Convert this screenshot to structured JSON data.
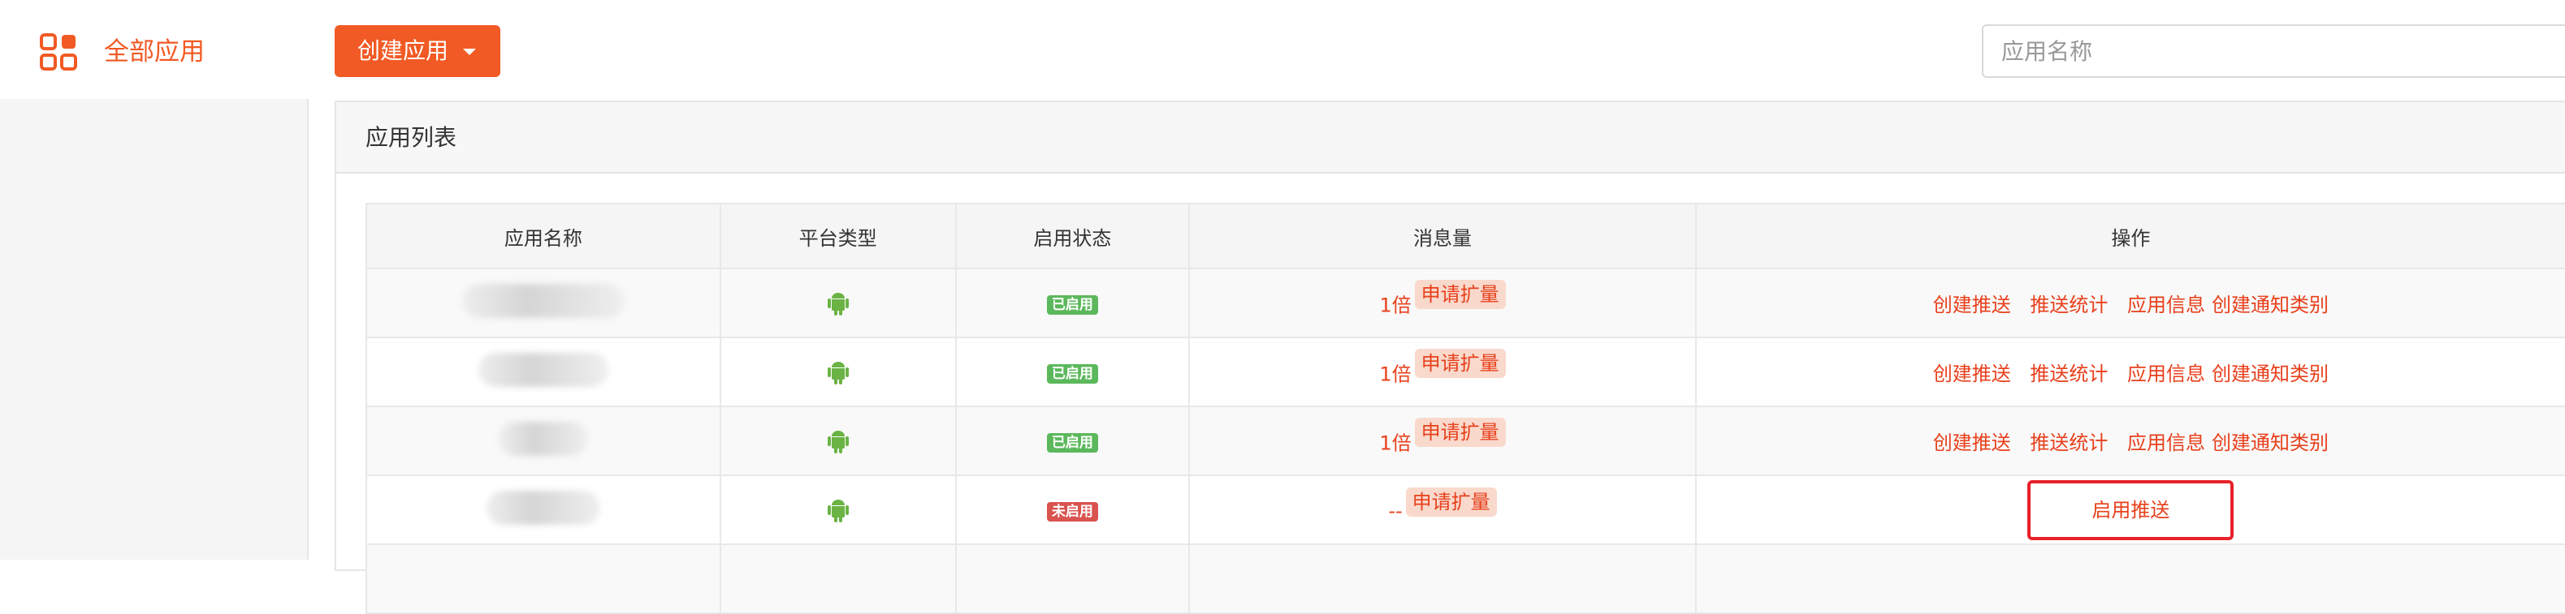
{
  "header": {
    "logo_icon": "grid-apps-icon",
    "title": "全部应用",
    "create_button": "创建应用",
    "search_placeholder": "应用名称",
    "accent_color": "#f15a24"
  },
  "panel": {
    "title": "应用列表"
  },
  "table": {
    "columns": [
      "应用名称",
      "平台类型",
      "启用状态",
      "消息量",
      "操作"
    ],
    "rows": [
      {
        "name": "",
        "platform_icon": "android-icon",
        "status": "已启用",
        "enabled": true,
        "message_count": "1倍",
        "expand_label": "申请扩量",
        "operations": [
          "创建推送",
          "推送统计",
          "应用信息",
          "创建通知类别"
        ]
      },
      {
        "name": "",
        "platform_icon": "android-icon",
        "status": "已启用",
        "enabled": true,
        "message_count": "1倍",
        "expand_label": "申请扩量",
        "operations": [
          "创建推送",
          "推送统计",
          "应用信息",
          "创建通知类别"
        ]
      },
      {
        "name": "",
        "platform_icon": "android-icon",
        "status": "已启用",
        "enabled": true,
        "message_count": "1倍",
        "expand_label": "申请扩量",
        "operations": [
          "创建推送",
          "推送统计",
          "应用信息",
          "创建通知类别"
        ]
      },
      {
        "name": "",
        "platform_icon": "android-icon",
        "status": "未启用",
        "enabled": false,
        "message_count": "--",
        "expand_label": "申请扩量",
        "operations": [
          "启用推送"
        ]
      }
    ]
  }
}
